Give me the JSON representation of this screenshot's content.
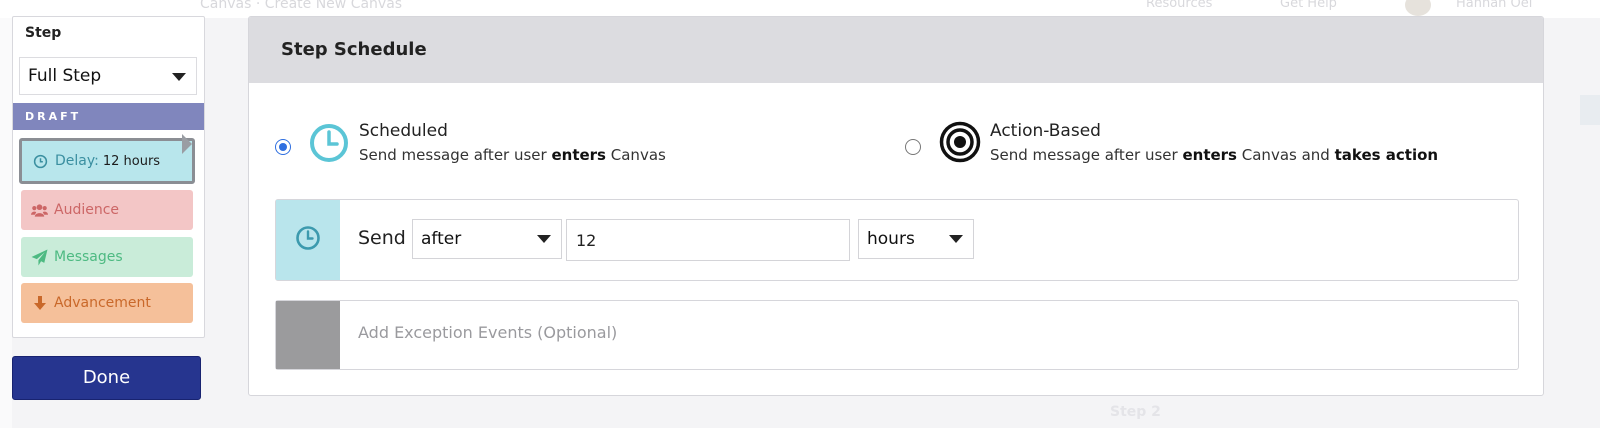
{
  "background": {
    "breadcrumb": "Canvas · Create New Canvas",
    "resources": "Resources",
    "get_help": "Get Help",
    "user": "Hannah Oel",
    "step2": "Step 2"
  },
  "step_panel": {
    "heading": "Step",
    "select_value": "Full Step",
    "draft_label": "DRAFT",
    "items": [
      {
        "label": "Delay:",
        "detail": "12 hours",
        "icon": "clock-icon"
      },
      {
        "label": "Audience",
        "icon": "users-icon"
      },
      {
        "label": "Messages",
        "icon": "paper-plane-icon"
      },
      {
        "label": "Advancement",
        "icon": "arrow-down-icon"
      }
    ],
    "done_label": "Done"
  },
  "schedule": {
    "title": "Step Schedule",
    "options": [
      {
        "title": "Scheduled",
        "desc_prefix": "Send message after user ",
        "desc_b1": "enters",
        "desc_mid": " Canvas",
        "desc_b2": "",
        "selected": true
      },
      {
        "title": "Action-Based",
        "desc_prefix": "Send message after user ",
        "desc_b1": "enters",
        "desc_mid": " Canvas and ",
        "desc_b2": "takes action",
        "selected": false
      }
    ],
    "send": {
      "label": "Send",
      "timing": "after",
      "amount": "12",
      "unit": "hours"
    },
    "exception_label": "Add Exception Events (Optional)"
  },
  "colors": {
    "accent": "#26358f",
    "draft": "#8086bd",
    "delay": "#b8e6ec",
    "audience": "#f3c6c6",
    "messages": "#c9ecd9",
    "advancement": "#f5c09a",
    "radio_selected": "#2f6fe0"
  }
}
